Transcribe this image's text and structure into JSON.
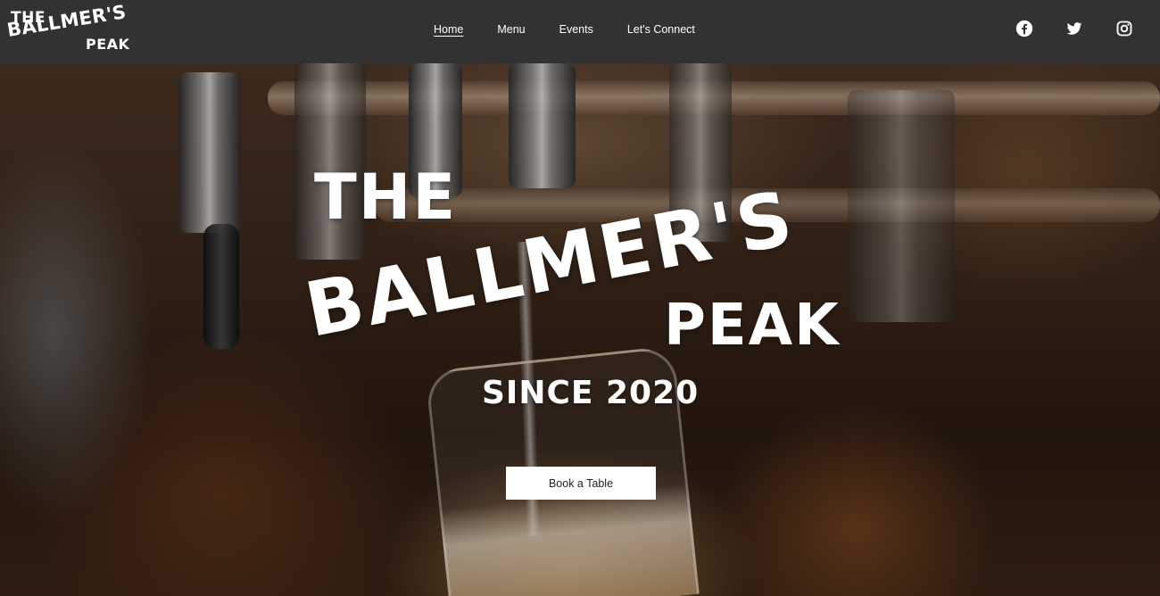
{
  "logo": {
    "line1": "THE",
    "line2": "BALLMER'S",
    "line3": "PEAK"
  },
  "nav": {
    "items": [
      {
        "label": "Home",
        "active": true
      },
      {
        "label": "Menu",
        "active": false
      },
      {
        "label": "Events",
        "active": false
      },
      {
        "label": "Let's Connect",
        "active": false
      }
    ]
  },
  "social": [
    {
      "icon": "facebook-icon"
    },
    {
      "icon": "twitter-icon"
    },
    {
      "icon": "instagram-icon"
    }
  ],
  "hero": {
    "title_line1": "THE",
    "title_line2": "BALLMER'S",
    "title_line3": "PEAK",
    "since": "SINCE 2020",
    "cta_label": "Book a Table"
  },
  "colors": {
    "navbar_bg": "#323232",
    "text": "#ffffff",
    "button_bg": "#ffffff",
    "button_text": "#222222"
  }
}
